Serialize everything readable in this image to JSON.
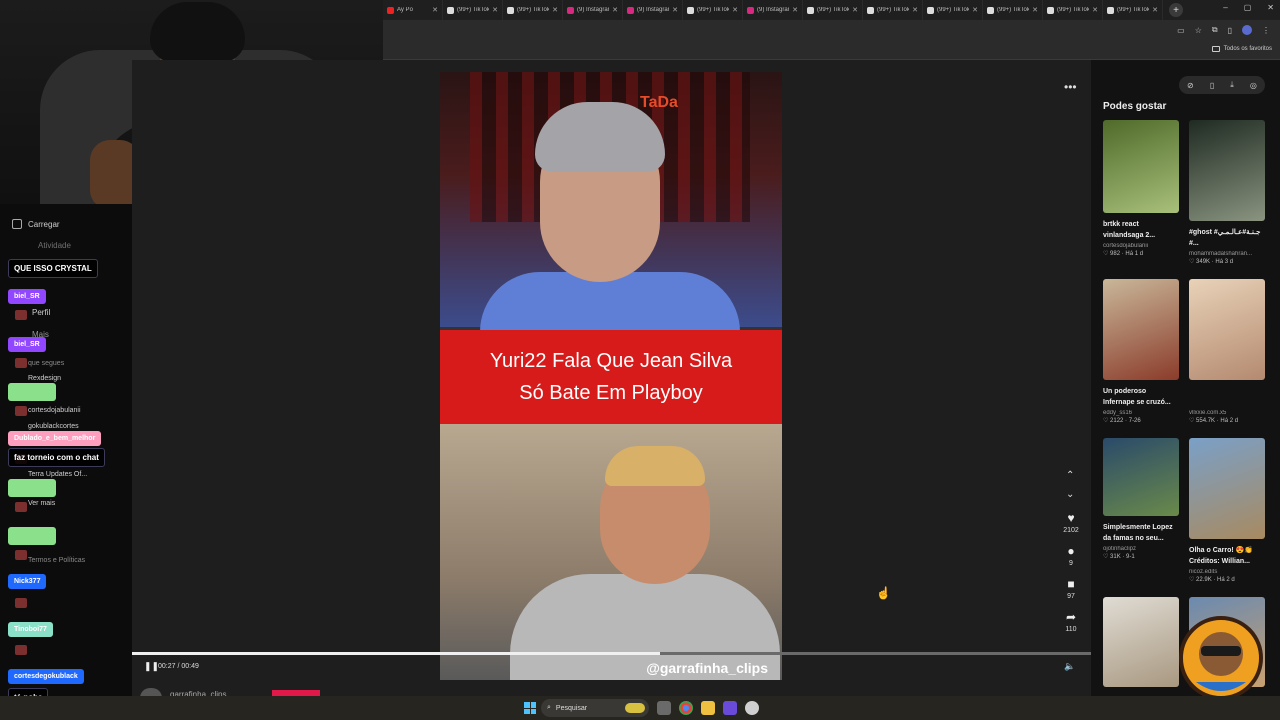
{
  "browser": {
    "tabs": [
      {
        "label": "Ay Po",
        "icon": "youtube-icon",
        "color": "#e22"
      },
      {
        "label": "(99+) TikTok",
        "icon": "tiktok-icon",
        "color": "#ddd"
      },
      {
        "label": "(99+) TikTok",
        "icon": "tiktok-icon",
        "color": "#ddd"
      },
      {
        "label": "(9) Instagram",
        "icon": "instagram-icon",
        "color": "#d6297f"
      },
      {
        "label": "(9) Instagram",
        "icon": "instagram-icon",
        "color": "#d6297f"
      },
      {
        "label": "(99+) TikTok",
        "icon": "tiktok-icon",
        "color": "#ddd"
      },
      {
        "label": "(9) Instagram",
        "icon": "instagram-icon",
        "color": "#d6297f"
      },
      {
        "label": "(99+) TikTok",
        "icon": "tiktok-icon",
        "color": "#ddd"
      },
      {
        "label": "(99+) TikTok",
        "icon": "tiktok-icon",
        "color": "#ddd"
      },
      {
        "label": "(99+) TikTok",
        "icon": "tiktok-icon",
        "color": "#ddd"
      },
      {
        "label": "(99+) TikTok",
        "icon": "tiktok-icon",
        "color": "#ddd"
      },
      {
        "label": "(99+) TikTok",
        "icon": "tiktok-icon",
        "color": "#ddd"
      },
      {
        "label": "(99+) TikTok",
        "icon": "tiktok-icon",
        "color": "#ddd"
      }
    ],
    "bookmarks_label": "Todos os favoritos"
  },
  "sidebar": {
    "nav": [
      {
        "label": "Carregar",
        "icon": "upload-icon"
      },
      {
        "label": "Atividade",
        "icon": "activity-icon"
      },
      {
        "label": "Perfil",
        "icon": "profile-icon"
      },
      {
        "label": "Mais",
        "icon": "more-icon"
      }
    ],
    "following_header": "que segues",
    "following": [
      {
        "name": "Rexdesign"
      },
      {
        "name": "cortesdojabulanii"
      },
      {
        "name": "gokublackcortes"
      },
      {
        "name": "Terra Updates Of..."
      }
    ],
    "see_more": "Ver mais",
    "footer": "Termos e Políticas"
  },
  "chat": [
    {
      "user": "QUE ISSO CRYSTAL",
      "color": "",
      "type": "msg"
    },
    {
      "user": "biel_SR",
      "color": "#9147ff",
      "type": "name"
    },
    {
      "user": "biel_SR",
      "color": "#9147ff",
      "type": "name"
    },
    {
      "user": "",
      "color": "#8be08b",
      "type": "name"
    },
    {
      "user": "Dublado_e_bem_melhor",
      "color": "#ff9fbf",
      "type": "name"
    },
    {
      "user": "faz torneio com o chat",
      "color": "",
      "type": "msg"
    },
    {
      "user": "",
      "color": "#8be08b",
      "type": "name"
    },
    {
      "user": "",
      "color": "#8be08b",
      "type": "name"
    },
    {
      "user": "Nick377",
      "color": "#1f69ff",
      "type": "name"
    },
    {
      "user": "Tinoboi77",
      "color": "#8be0c8",
      "type": "name"
    },
    {
      "user": "cortesdegokublack",
      "color": "#1f69ff",
      "type": "name"
    },
    {
      "user": "tá poha",
      "color": "",
      "type": "msg"
    }
  ],
  "video": {
    "logo": "TaDa",
    "caption_line1": "Yuri22 Fala Que Jean Silva",
    "caption_line2": "Só Bate Em Playboy",
    "handle": "@garrafinha_clips",
    "time": "00:27 / 00:49",
    "progress": 0.551,
    "author": "garrafinha_clips"
  },
  "actions": {
    "likes": "2102",
    "comments": "9",
    "saves": "97",
    "shares": "110"
  },
  "right_panel": {
    "title": "Podes gostar",
    "cards": [
      {
        "title": "brtkk react vinlandsaga 2...",
        "author": "cortesdojabulanii",
        "stats": "♡ 982 · Há 1 d",
        "c1": "#4f6a2a",
        "c2": "#a8c07a",
        "h": 93
      },
      {
        "title": "#ghost #جـنـة#عـالـمـي #...",
        "author": "mohammadalshahran...",
        "stats": "♡ 349K · Há 3 d",
        "c1": "#1f2a22",
        "c2": "#8a9480",
        "h": 101
      },
      {
        "title": "Un poderoso Infernape se cruzó...",
        "author": "eddy_ss16",
        "stats": "♡ 2122 · 7-26",
        "c1": "#c9b79a",
        "c2": "#8b3c2a",
        "h": 101
      },
      {
        "title": "",
        "author": "vllxxie.com.x5",
        "stats": "♡ 554.7K · Há 2 d",
        "c1": "#e8d2b8",
        "c2": "#b48a70",
        "h": 101
      },
      {
        "title": "Simplesmente Lopez da famas no seu...",
        "author": "ojotinhaclipz",
        "stats": "♡ 31K · 9-1",
        "c1": "#2a4a6a",
        "c2": "#6a8a4a",
        "h": 78
      },
      {
        "title": "Olha o Carro! 😍👏 Créditos: Willian...",
        "author": "nicoz.edits",
        "stats": "♡ 22.9K · Há 2 d",
        "c1": "#7aa0c8",
        "c2": "#a88a60",
        "h": 101
      },
      {
        "title": "",
        "author": "",
        "stats": "",
        "c1": "#e0dcd4",
        "c2": "#a89880",
        "h": 90
      },
      {
        "title": "",
        "author": "",
        "stats": "",
        "c1": "#6a8ab0",
        "c2": "#c8a070",
        "h": 90
      }
    ]
  },
  "taskbar": {
    "search": "Pesquisar"
  },
  "colors": {
    "accent_red": "#d71a1a",
    "follow_pink": "#e0194a",
    "windows_blue": "#4cc2ff"
  }
}
